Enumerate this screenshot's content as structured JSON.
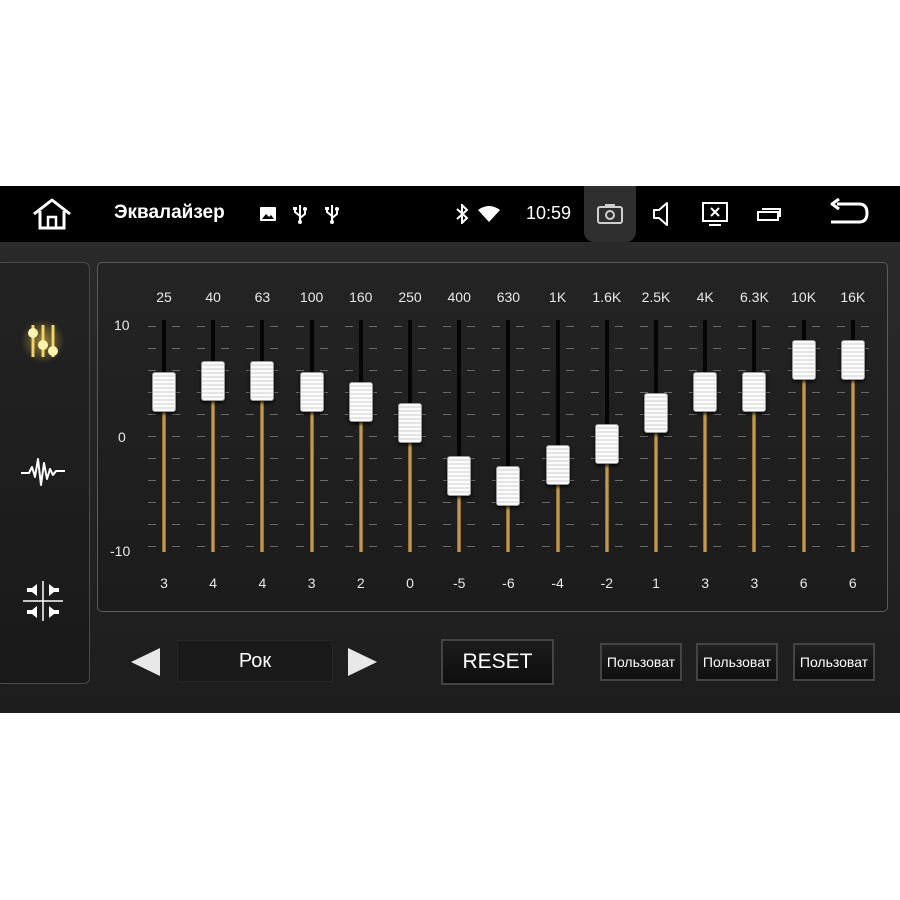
{
  "status_bar": {
    "title": "Эквалайзер",
    "time": "10:59",
    "icons": [
      "home-icon",
      "gallery-icon",
      "usb-icon",
      "usb-icon",
      "bluetooth-icon",
      "wifi-icon",
      "screenshot-icon",
      "volume-icon",
      "screen-off-icon",
      "recent-apps-icon",
      "back-icon"
    ]
  },
  "sidebar": {
    "items": [
      {
        "icon": "equalizer-sliders-icon",
        "active": true
      },
      {
        "icon": "waveform-icon",
        "active": false
      },
      {
        "icon": "speaker-balance-icon",
        "active": false
      }
    ]
  },
  "equalizer": {
    "scale": {
      "top": "10",
      "middle": "0",
      "bottom": "-10",
      "min": -10,
      "max": 10
    },
    "bands": [
      {
        "freq": "25",
        "value": 3
      },
      {
        "freq": "40",
        "value": 4
      },
      {
        "freq": "63",
        "value": 4
      },
      {
        "freq": "100",
        "value": 3
      },
      {
        "freq": "160",
        "value": 2
      },
      {
        "freq": "250",
        "value": 0
      },
      {
        "freq": "400",
        "value": -5
      },
      {
        "freq": "630",
        "value": -6
      },
      {
        "freq": "1K",
        "value": -4
      },
      {
        "freq": "1.6K",
        "value": -2
      },
      {
        "freq": "2.5K",
        "value": 1
      },
      {
        "freq": "4K",
        "value": 3
      },
      {
        "freq": "6.3K",
        "value": 3
      },
      {
        "freq": "10K",
        "value": 6
      },
      {
        "freq": "16K",
        "value": 6
      }
    ]
  },
  "controls": {
    "preset": "Рок",
    "reset_label": "RESET",
    "user_presets": [
      "Пользоват",
      "Пользоват",
      "Пользоват"
    ]
  },
  "colors": {
    "accent": "#d9b061",
    "active_icon": "#e8c24a"
  }
}
